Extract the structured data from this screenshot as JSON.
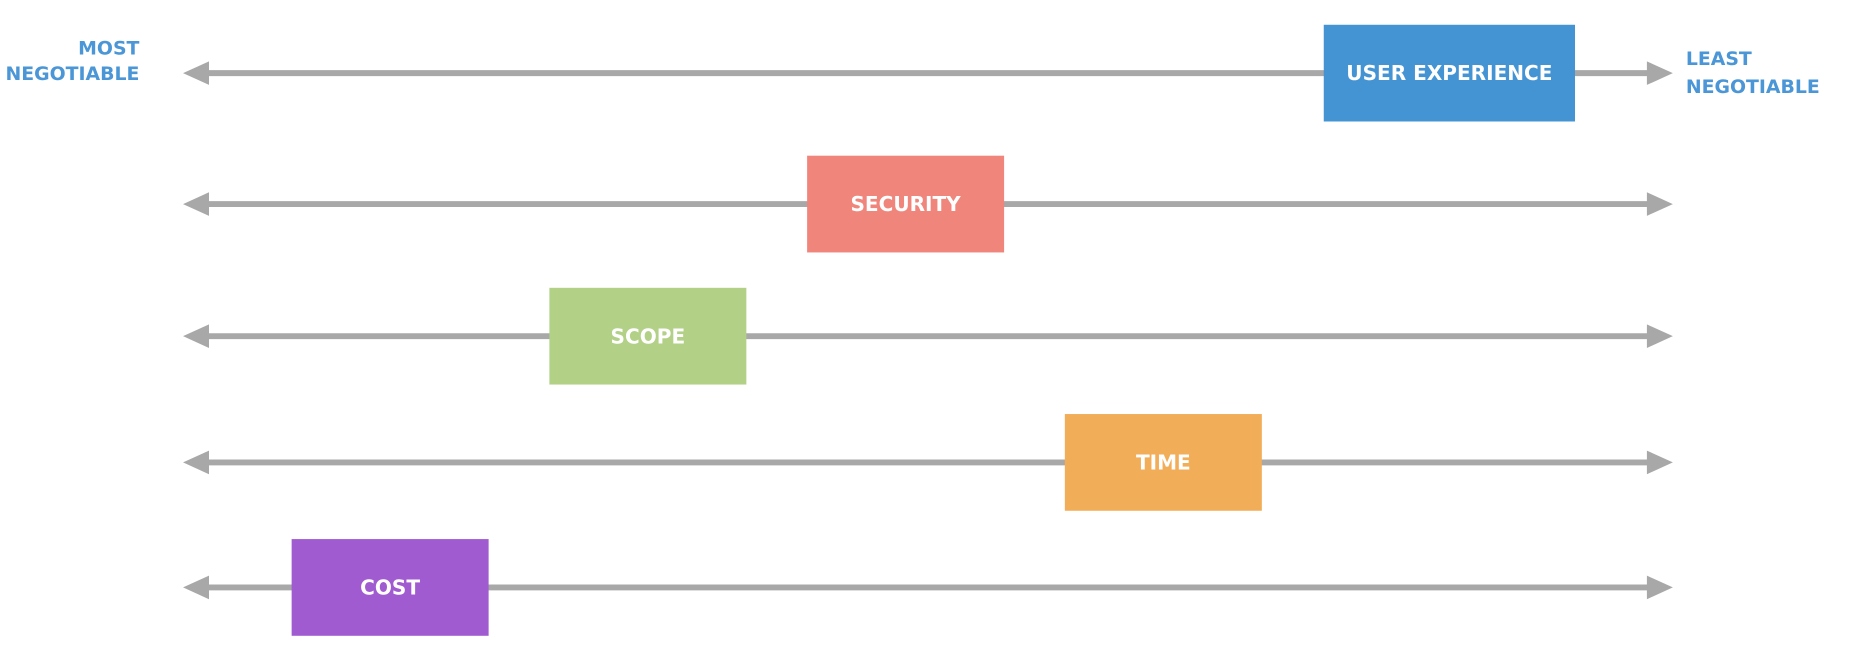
{
  "scale": {
    "left_label": [
      "MOST",
      "NEGOTIABLE"
    ],
    "right_label": [
      "LEAST",
      "NEGOTIABLE"
    ],
    "line_color": "#a8a8a8",
    "label_color": "#4a96d6"
  },
  "items": [
    {
      "label": "USER EXPERIENCE",
      "color": "#4494d4",
      "position": 0.85
    },
    {
      "label": "SECURITY",
      "color": "#f0857b",
      "position": 0.485
    },
    {
      "label": "SCOPE",
      "color": "#b2d086",
      "position": 0.312
    },
    {
      "label": "TIME",
      "color": "#f2ad59",
      "position": 0.658
    },
    {
      "label": "COST",
      "color": "#a05bd0",
      "position": 0.139
    }
  ]
}
